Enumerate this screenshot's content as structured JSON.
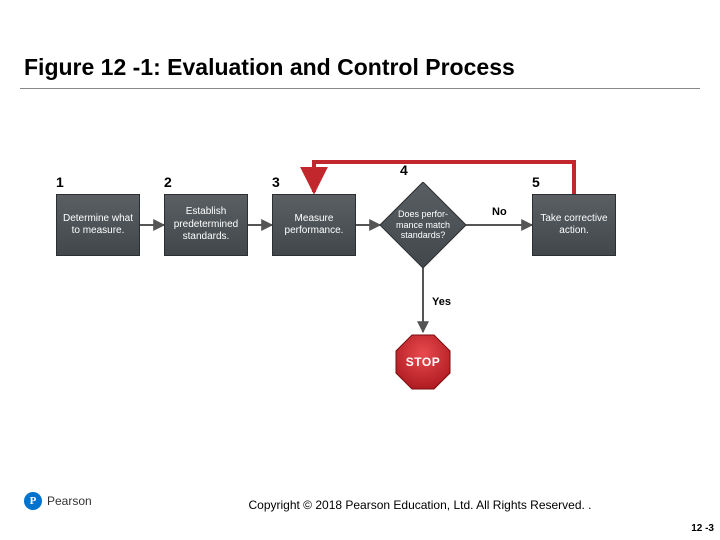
{
  "title": "Figure 12 -1: Evaluation and Control Process",
  "steps": {
    "n1": "1",
    "n2": "2",
    "n3": "3",
    "n4": "4",
    "n5": "5",
    "box1": "Determine what to measure.",
    "box2": "Establish predetermined standards.",
    "box3": "Measure performance.",
    "diamond": "Does perfor- mance match standards?",
    "box5": "Take corrective action."
  },
  "labels": {
    "no": "No",
    "yes": "Yes",
    "stop": "STOP"
  },
  "footer": {
    "brand": "Pearson",
    "copyright": "Copyright © 2018 Pearson Education, Ltd. All Rights Reserved. .",
    "pagenum": "12 -3"
  },
  "colors": {
    "accent": "#c1272d",
    "box": "#4d5357"
  }
}
